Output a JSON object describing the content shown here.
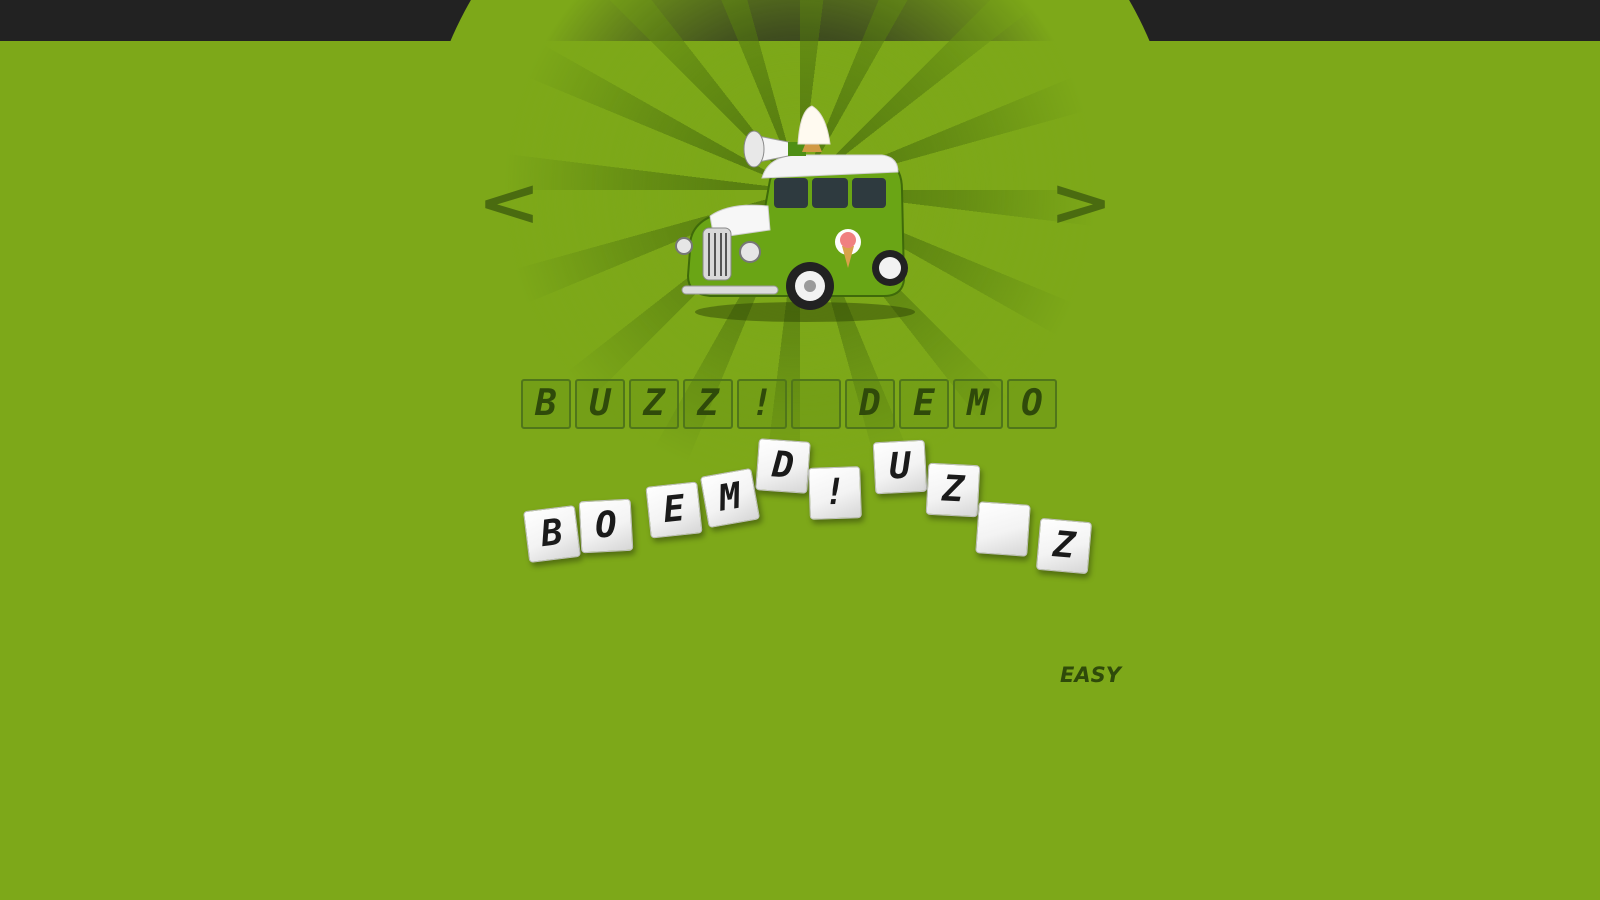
{
  "nav": {
    "prev": "<",
    "next": ">"
  },
  "puzzle": {
    "image": "ice-cream-truck",
    "answer_slots": [
      "B",
      "U",
      "Z",
      "Z",
      "!",
      "",
      "D",
      "E",
      "M",
      "O"
    ],
    "letter_tiles": [
      "B",
      "O",
      "E",
      "M",
      "D",
      "!",
      "U",
      "Z",
      "",
      "Z"
    ]
  },
  "difficulty": "EASY",
  "colors": {
    "background": "#7da819",
    "topbar": "#222222",
    "slot_border": "#50761a",
    "text_dark": "#2f4a0a",
    "tile_face": "#f3f3f3"
  }
}
